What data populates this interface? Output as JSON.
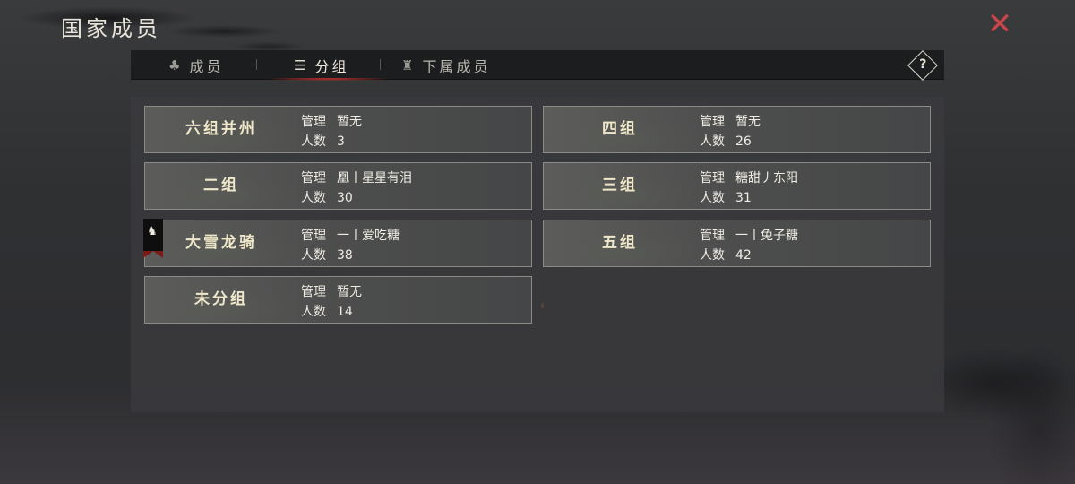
{
  "page_title": "国家成员",
  "close_icon_char": "✕",
  "tabs": [
    {
      "label": "成员",
      "icon": "bell-icon",
      "glyph": "♣",
      "active": false
    },
    {
      "label": "分组",
      "icon": "list-icon",
      "glyph": "☰",
      "active": true
    },
    {
      "label": "下属成员",
      "icon": "tower-icon",
      "glyph": "♜",
      "active": false
    }
  ],
  "help_label": "?",
  "labels": {
    "manager": "管理",
    "count": "人数"
  },
  "groups": [
    {
      "name": "六组并州",
      "manager": "暂无",
      "count": "3"
    },
    {
      "name": "四组",
      "manager": "暂无",
      "count": "26"
    },
    {
      "name": "二组",
      "manager": "凰丨星星有泪",
      "count": "30"
    },
    {
      "name": "三组",
      "manager": "糖甜丿东阳",
      "count": "31"
    },
    {
      "name": "大雪龙骑",
      "manager": "一丨爱吃糖",
      "count": "38",
      "flag": true
    },
    {
      "name": "五组",
      "manager": "一丨兔子糖",
      "count": "42"
    },
    {
      "name": "未分组",
      "manager": "暂无",
      "count": "14"
    }
  ],
  "colors": {
    "accent_red": "#d2332d",
    "close_red": "#c9474a",
    "group_name_gold": "#efe7c9"
  }
}
